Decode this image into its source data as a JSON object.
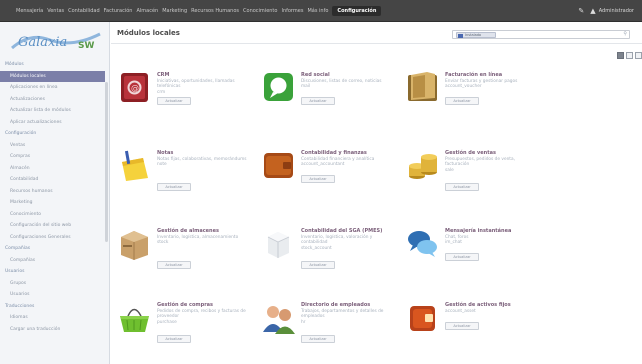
{
  "topbar": {
    "menu": [
      "Mensajería",
      "Ventas",
      "Contabilidad",
      "Facturación",
      "Almacén",
      "Marketing",
      "Recursos Humanos",
      "Conocimiento",
      "Informes",
      "Más info",
      "Configuración"
    ],
    "active": "Configuración",
    "user": "Administrador"
  },
  "sidebar": {
    "logo": "Galaxia SW",
    "items": [
      {
        "label": "Módulos",
        "type": "section"
      },
      {
        "label": "Módulos locales",
        "type": "item",
        "active": true
      },
      {
        "label": "Aplicaciones en línea",
        "type": "item"
      },
      {
        "label": "Actualizaciones",
        "type": "item"
      },
      {
        "label": "Actualizar lista de módulos",
        "type": "item"
      },
      {
        "label": "Aplicar actualizaciones",
        "type": "item"
      },
      {
        "label": "Configuración",
        "type": "section"
      },
      {
        "label": "Ventas",
        "type": "item"
      },
      {
        "label": "Compras",
        "type": "item"
      },
      {
        "label": "Almacén",
        "type": "item"
      },
      {
        "label": "Contabilidad",
        "type": "item"
      },
      {
        "label": "Recursos humanos",
        "type": "item"
      },
      {
        "label": "Marketing",
        "type": "item"
      },
      {
        "label": "Conocimiento",
        "type": "item"
      },
      {
        "label": "Configuración del sitio web",
        "type": "item"
      },
      {
        "label": "Configuraciones Generales",
        "type": "item"
      },
      {
        "label": "Compañías",
        "type": "section"
      },
      {
        "label": "Compañías",
        "type": "item"
      },
      {
        "label": "Usuarios",
        "type": "section"
      },
      {
        "label": "Grupos",
        "type": "item"
      },
      {
        "label": "Usuarios",
        "type": "item"
      },
      {
        "label": "Traducciones",
        "type": "section"
      },
      {
        "label": "Idiomas",
        "type": "item"
      },
      {
        "label": "Cargar una traducción",
        "type": "item"
      }
    ]
  },
  "main": {
    "title": "Módulos locales",
    "search_chip": "Instalado",
    "cards": [
      {
        "name": "CRM",
        "desc": "Iniciativas, oportunidades, llamadas telefónicas",
        "tech": "crm",
        "button": "Actualizar",
        "icon": "crm-icon"
      },
      {
        "name": "Red social",
        "desc": "Discusiones, listas de correo, noticias",
        "tech": "mail",
        "button": "Actualizar",
        "icon": "speech-bubble-icon"
      },
      {
        "name": "Facturación en línea",
        "desc": "Enviar facturas y gestionar pagos",
        "tech": "account_voucher",
        "button": "Actualizar",
        "icon": "invoice-folder-icon"
      },
      {
        "name": "Notas",
        "desc": "Notas fijas, colaborativas, memorándums",
        "tech": "note",
        "button": "Actualizar",
        "icon": "notes-icon"
      },
      {
        "name": "Contabilidad y finanzas",
        "desc": "Contabilidad financiera y analítica",
        "tech": "account_accountant",
        "button": "Actualizar",
        "icon": "wallet-icon"
      },
      {
        "name": "Gestión de ventas",
        "desc": "Presupuestos, pedidos de venta, facturación",
        "tech": "sale",
        "button": "Actualizar",
        "icon": "coins-icon"
      },
      {
        "name": "Gestión de almacenes",
        "desc": "Inventario, logística, almacenamiento",
        "tech": "stock",
        "button": "Actualizar",
        "icon": "box-icon"
      },
      {
        "name": "Contabilidad del SGA (PMES)",
        "desc": "Inventario, logística, valoración y contabilidad",
        "tech": "stock_account",
        "button": "Actualizar",
        "icon": "package-icon"
      },
      {
        "name": "Mensajería instantánea",
        "desc": "Chat, foros",
        "tech": "im_chat",
        "button": "Actualizar",
        "icon": "chat-bubbles-icon"
      },
      {
        "name": "Gestión de compras",
        "desc": "Pedidos de compra, recibos y facturas de proveedor",
        "tech": "purchase",
        "button": "Actualizar",
        "icon": "basket-icon"
      },
      {
        "name": "Directorio de empleados",
        "desc": "Trabajos, departamentos y detalles de empleados",
        "tech": "hr",
        "button": "Actualizar",
        "icon": "employees-icon"
      },
      {
        "name": "Gestión de activos fijos",
        "desc": "account_asset",
        "tech": "",
        "button": "Actualizar",
        "icon": "asset-wallet-icon"
      }
    ]
  }
}
